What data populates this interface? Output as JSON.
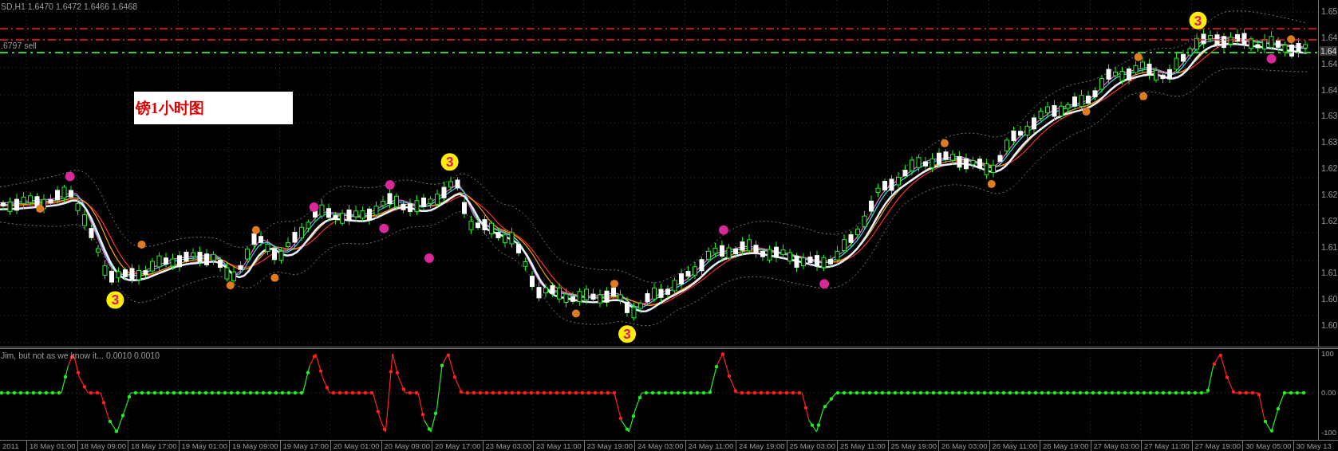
{
  "main_chart": {
    "header": "SD,H1  1.6470 1.6472 1.6466 1.6468",
    "sell_line_label": ".6797 sell",
    "title_box": "镑1小时图",
    "wave_badges": [
      "3",
      "3",
      "3",
      "3"
    ],
    "price_axis": [
      "1.65",
      "1.64",
      "1.64",
      "1.64",
      "1.63",
      "1.63",
      "1.62",
      "1.62",
      "1.62",
      "1.61",
      "1.61",
      "1.60",
      "1.60"
    ],
    "current_price": "1.64"
  },
  "indicator": {
    "label": "Jim, but not as we know it...  0.0010 0.0010",
    "axis": [
      "100",
      "0.00",
      "-100"
    ]
  },
  "time_axis": [
    "2011",
    "18 May 01:00",
    "18 May 09:00",
    "18 May 17:00",
    "19 May 01:00",
    "19 May 09:00",
    "19 May 17:00",
    "20 May 01:00",
    "20 May 09:00",
    "20 May 17:00",
    "23 May 03:00",
    "23 May 11:00",
    "23 May 19:00",
    "24 May 03:00",
    "24 May 11:00",
    "24 May 19:00",
    "25 May 03:00",
    "25 May 11:00",
    "25 May 19:00",
    "26 May 03:00",
    "26 May 11:00",
    "26 May 19:00",
    "27 May 03:00",
    "27 May 11:00",
    "27 May 19:00",
    "30 May 05:00",
    "30 May 13"
  ]
}
